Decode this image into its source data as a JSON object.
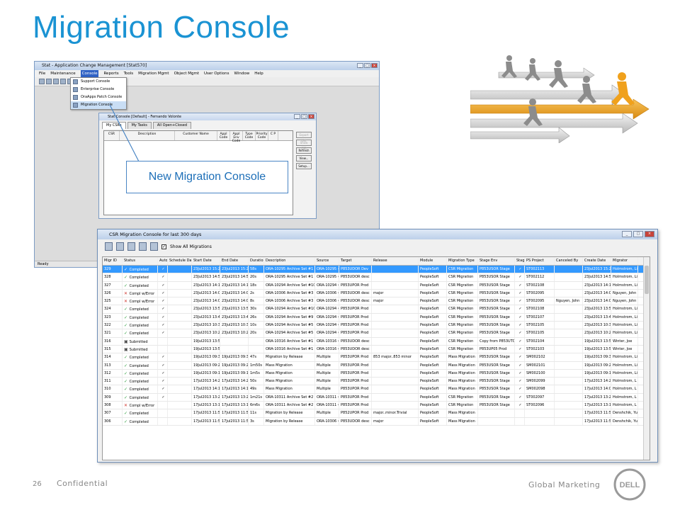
{
  "slide": {
    "title": "Migration Console",
    "page_number": "26",
    "confidential": "Confidential",
    "global_marketing": "Global Marketing",
    "logo_text": "DELL"
  },
  "app_window": {
    "title": "Stat - Application Change Management  [Stat570]",
    "menu": [
      "File",
      "Maintenance",
      "Console",
      "Reports",
      "Tools",
      "Migration Mgmt",
      "Object Mgmt",
      "User Options",
      "Window",
      "Help"
    ],
    "selected_menu": "Console",
    "dropdown": [
      "Support Console",
      "Enterprise Console",
      "OraApps Patch Console",
      "Migration Console"
    ],
    "status": "Ready"
  },
  "console_dialog": {
    "title": "Stat Console [Default] - Fernando Volonte",
    "tabs": [
      "My CSRs",
      "My Tasks",
      "All Open+Closed"
    ],
    "columns": [
      "CSR",
      "Description",
      "Customer Name",
      "Appl Code",
      "Appl Env Code",
      "Type Code",
      "Priority Code",
      "C P"
    ],
    "buttons": [
      "Export List",
      "Show CSR",
      "Refresh",
      "View...",
      "Setup..."
    ]
  },
  "callout": "New Migration Console",
  "migration_console": {
    "title": "CSR Migration Console for last 300 days",
    "show_all_label": "Show All Migrations",
    "columns": [
      "Migr ID",
      "Status",
      "Auto",
      "Schedule Date",
      "Start Date",
      "End Date",
      "Duration",
      "Description",
      "Source",
      "Target",
      "Release",
      "Module",
      "Migration Type",
      "Stage Env",
      "Staged",
      "PS Project",
      "Canceled By",
      "Create Date",
      "Migrator"
    ],
    "rows": [
      [
        "329",
        "ok",
        "Completed",
        "✓",
        "",
        "23Jul2013 15:22",
        "23Jul2013 15:23",
        "58s",
        "ORA-10295 Archive Set #1",
        "ORA-10295 #1",
        "P853UDOR Dev",
        "",
        "PeopleSoft",
        "CSR Migration",
        "P853USOR Stage",
        "✓",
        "ST002113",
        "",
        "23Jul2013 15:22",
        "Holmstrom, Linnea"
      ],
      [
        "328",
        "ok",
        "Completed",
        "✓",
        "",
        "23Jul2013 14:58",
        "23Jul2013 14:58",
        "20s",
        "ORA-10295 Archive Set #1",
        "ORA-10295 #1",
        "P853UDOR desc",
        "",
        "PeopleSoft",
        "CSR Migration",
        "P853USOR Stage",
        "✓",
        "ST002112",
        "",
        "23Jul2013 14:58",
        "Holmstrom, Linnea"
      ],
      [
        "327",
        "ok",
        "Completed",
        "✓",
        "",
        "23Jul2013 14:16",
        "23Jul2013 14:17",
        "18s",
        "ORA-10294 Archive Set #10",
        "ORA-10294 #1",
        "P853UPOR Prod",
        "",
        "PeopleSoft",
        "CSR Migration",
        "P853USOR Stage",
        "✓",
        "ST002108",
        "",
        "23Jul2013 14:16",
        "Holmstrom, Linnea"
      ],
      [
        "326",
        "err",
        "Compl w/Error",
        "✓",
        "",
        "23Jul2013 14:08",
        "23Jul2013 14:08",
        "2s",
        "ORA-10306 Archive Set #3",
        "ORA-10306 #1",
        "P853UDOR desc",
        "major",
        "PeopleSoft",
        "CSR Migration",
        "P853USOR Stage",
        "✓",
        "ST002095",
        "",
        "23Jul2013 14:07",
        "Nguyen, John"
      ],
      [
        "325",
        "err",
        "Compl w/Error",
        "✓",
        "",
        "23Jul2013 14:06",
        "23Jul2013 14:06",
        "8s",
        "ORA-10306 Archive Set #3",
        "ORA-10306 #1",
        "P853UDOR desc",
        "major",
        "PeopleSoft",
        "CSR Migration",
        "P853USOR Stage",
        "✓",
        "ST002095",
        "Nguyen, John",
        "23Jul2013 14:06",
        "Nguyen, John"
      ],
      [
        "324",
        "ok",
        "Completed",
        "✓",
        "",
        "23Jul2013 13:51",
        "23Jul2013 13:52",
        "30s",
        "ORA-10294 Archive Set #10",
        "ORA-10294 #1",
        "P853UPOR Prod",
        "",
        "PeopleSoft",
        "CSR Migration",
        "P853USOR Stage",
        "✓",
        "ST002108",
        "",
        "23Jul2013 13:51",
        "Holmstrom, Linnea"
      ],
      [
        "323",
        "ok",
        "Completed",
        "✓",
        "",
        "23Jul2013 13:44",
        "23Jul2013 13:44",
        "26s",
        "ORA-10294 Archive Set #9",
        "ORA-10294 #9",
        "P853UPOR Prod",
        "",
        "PeopleSoft",
        "CSR Migration",
        "P853USOR Stage",
        "✓",
        "ST002107",
        "",
        "23Jul2013 13:44",
        "Holmstrom, Linnea"
      ],
      [
        "322",
        "ok",
        "Completed",
        "✓",
        "",
        "23Jul2013 10:35",
        "23Jul2013 10:35",
        "10s",
        "ORA-10294 Archive Set #5",
        "ORA-10294 #5",
        "P853UPOR Prod",
        "",
        "PeopleSoft",
        "CSR Migration",
        "P853USOR Stage",
        "✓",
        "ST002105",
        "",
        "23Jul2013 10:35",
        "Holmstrom, Linnea"
      ],
      [
        "321",
        "ok",
        "Completed",
        "✓",
        "",
        "23Jul2013 10:23",
        "23Jul2013 10:24",
        "20s",
        "ORA-10294 Archive Set #5",
        "ORA-10294 #5",
        "P853UPOR Prod",
        "",
        "PeopleSoft",
        "CSR Migration",
        "P853USOR Stage",
        "✓",
        "ST002105",
        "",
        "23Jul2013 10:23",
        "Holmstrom, Linnea"
      ],
      [
        "316",
        "sub",
        "Submitted",
        "",
        "",
        "19Jul2013 13:58",
        "",
        "",
        "ORA-10316 Archive Set #1",
        "ORA-10316 #1",
        "P853UDOR desc",
        "",
        "PeopleSoft",
        "CSR Migration",
        "Copy from P853UT05",
        "✓",
        "ST002104",
        "",
        "19Jul2013 13:58",
        "Winter, Joe"
      ],
      [
        "315",
        "sub",
        "Submitted",
        "",
        "",
        "19Jul2013 13:51",
        "",
        "",
        "ORA-10316 Archive Set #1",
        "ORA-10316 #1",
        "P853UDOR desc",
        "",
        "PeopleSoft",
        "CSR Migration",
        "P853UP05 Prod",
        "✓",
        "ST002103",
        "",
        "19Jul2013 13:51",
        "Winter, Joe"
      ],
      [
        "314",
        "ok",
        "Completed",
        "✓",
        "",
        "19Jul2013 09:30",
        "19Jul2013 09:31",
        "47s",
        "Migration by Release",
        "Multiple",
        "P853UPOR Prod",
        "853 major..853 minor",
        "PeopleSoft",
        "Mass Migration",
        "P853USOR Stage",
        "✓",
        "SM002102",
        "",
        "19Jul2013 09:30",
        "Holmstrom, Linnea"
      ],
      [
        "313",
        "ok",
        "Completed",
        "✓",
        "",
        "19Jul2013 09:23",
        "19Jul2013 09:24",
        "1m50s",
        "Mass Migration",
        "Multiple",
        "P853UPOR Prod",
        "",
        "PeopleSoft",
        "Mass Migration",
        "P853USOR Stage",
        "✓",
        "SM002101",
        "",
        "19Jul2013 09:22",
        "Holmstrom, Linnea"
      ],
      [
        "312",
        "ok",
        "Completed",
        "✓",
        "",
        "19Jul2013 09:14",
        "19Jul2013 09:15",
        "1m5s",
        "Mass Migration",
        "Multiple",
        "P853UPOR Prod",
        "",
        "PeopleSoft",
        "Mass Migration",
        "P853USOR Stage",
        "✓",
        "SM002100",
        "",
        "19Jul2013 09:14",
        "Holmstrom, Linnea"
      ],
      [
        "311",
        "ok",
        "Completed",
        "✓",
        "",
        "17Jul2013 14:24",
        "17Jul2013 14:24",
        "50s",
        "Mass Migration",
        "Multiple",
        "P853UPOR Prod",
        "",
        "PeopleSoft",
        "Mass Migration",
        "P853USOR Stage",
        "✓",
        "SM002099",
        "",
        "17Jul2013 14:23",
        "Holmstrom, L"
      ],
      [
        "310",
        "ok",
        "Completed",
        "✓",
        "",
        "17Jul2013 14:11",
        "17Jul2013 14:11",
        "49s",
        "Mass Migration",
        "Multiple",
        "P853UPOR Prod",
        "",
        "PeopleSoft",
        "Mass Migration",
        "P853USOR Stage",
        "✓",
        "SM002098",
        "",
        "17Jul2013 14:09",
        "Holmstrom, L"
      ],
      [
        "309",
        "ok",
        "Completed",
        "✓",
        "",
        "17Jul2013 13:28",
        "17Jul2013 13:29",
        "1m21s",
        "ORA-10311 Archive Set #2",
        "ORA-10311 #2",
        "P853UPOR Prod",
        "",
        "PeopleSoft",
        "CSR Migration",
        "P853USOR Stage",
        "✓",
        "ST002097",
        "",
        "17Jul2013 13:28",
        "Holmstrom, L"
      ],
      [
        "308",
        "err",
        "Compl w/Error",
        "",
        "",
        "17Jul2013 13:13",
        "17Jul2013 13:19",
        "6m6s",
        "ORA-10311 Archive Set #2",
        "ORA-10311 #2",
        "P853UPOR Prod",
        "",
        "PeopleSoft",
        "CSR Migration",
        "P853USOR Stage",
        "✓",
        "ST002096",
        "",
        "17Jul2013 13:13",
        "Holmstrom, L"
      ],
      [
        "307",
        "ok",
        "Completed",
        "",
        "",
        "17Jul2013 11:58",
        "17Jul2013 11:58",
        "11s",
        "Migration by Release",
        "Multiple",
        "P852UPOR Prod",
        "major..minor.Trivial",
        "PeopleSoft",
        "Mass Migration",
        "",
        "",
        "",
        "",
        "17Jul2013 11:58",
        "Denshchik, Yuri"
      ],
      [
        "306",
        "ok",
        "Completed",
        "",
        "",
        "17Jul2013 11:50",
        "17Jul2013 11:50",
        "3s",
        "Migration by Release",
        "ORA-10306 #3",
        "P853UDOR desc",
        "major",
        "PeopleSoft",
        "Mass Migration",
        "",
        "",
        "",
        "",
        "17Jul2013 11:50",
        "Denshchik, Yuri"
      ]
    ]
  },
  "colors": {
    "title_blue": "#1a93d3",
    "selection_blue": "#3399ff",
    "runner_orange": "#f0a11c",
    "runner_gray": "#8c8c8c",
    "footer_gray": "#888888"
  }
}
